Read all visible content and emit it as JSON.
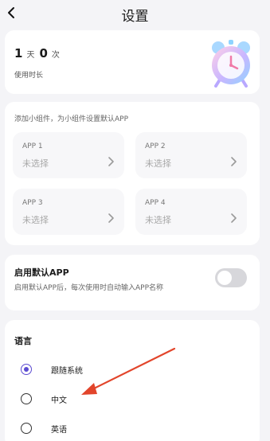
{
  "header": {
    "title": "设置"
  },
  "usage": {
    "days": "1",
    "days_unit": "天",
    "times": "0",
    "times_unit": "次",
    "label": "使用时长"
  },
  "widgets": {
    "hint": "添加小组件，为小组件设置默认APP",
    "apps": [
      {
        "name": "APP 1",
        "value": "未选择"
      },
      {
        "name": "APP 2",
        "value": "未选择"
      },
      {
        "name": "APP 3",
        "value": "未选择"
      },
      {
        "name": "APP 4",
        "value": "未选择"
      }
    ]
  },
  "default_app": {
    "title": "启用默认APP",
    "description": "启用默认APP后，每次使用时自动输入APP名称",
    "enabled": false
  },
  "language": {
    "title": "语言",
    "options": [
      {
        "label": "跟随系统",
        "selected": true
      },
      {
        "label": "中文",
        "selected": false
      },
      {
        "label": "英语",
        "selected": false
      }
    ]
  },
  "colors": {
    "accent": "#5b4bd1",
    "annotation_arrow": "#e2452b",
    "background": "#f4f4f7"
  }
}
